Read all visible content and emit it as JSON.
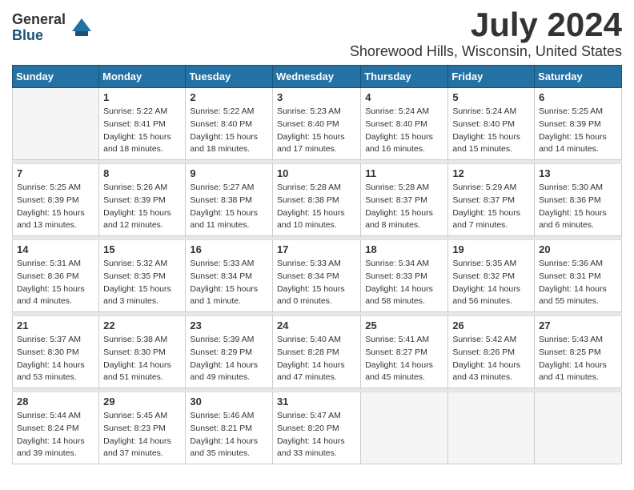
{
  "logo": {
    "general": "General",
    "blue": "Blue"
  },
  "title": "July 2024",
  "location": "Shorewood Hills, Wisconsin, United States",
  "days_of_week": [
    "Sunday",
    "Monday",
    "Tuesday",
    "Wednesday",
    "Thursday",
    "Friday",
    "Saturday"
  ],
  "weeks": [
    [
      {
        "day": "",
        "info": ""
      },
      {
        "day": "1",
        "info": "Sunrise: 5:22 AM\nSunset: 8:41 PM\nDaylight: 15 hours\nand 18 minutes."
      },
      {
        "day": "2",
        "info": "Sunrise: 5:22 AM\nSunset: 8:40 PM\nDaylight: 15 hours\nand 18 minutes."
      },
      {
        "day": "3",
        "info": "Sunrise: 5:23 AM\nSunset: 8:40 PM\nDaylight: 15 hours\nand 17 minutes."
      },
      {
        "day": "4",
        "info": "Sunrise: 5:24 AM\nSunset: 8:40 PM\nDaylight: 15 hours\nand 16 minutes."
      },
      {
        "day": "5",
        "info": "Sunrise: 5:24 AM\nSunset: 8:40 PM\nDaylight: 15 hours\nand 15 minutes."
      },
      {
        "day": "6",
        "info": "Sunrise: 5:25 AM\nSunset: 8:39 PM\nDaylight: 15 hours\nand 14 minutes."
      }
    ],
    [
      {
        "day": "7",
        "info": "Sunrise: 5:25 AM\nSunset: 8:39 PM\nDaylight: 15 hours\nand 13 minutes."
      },
      {
        "day": "8",
        "info": "Sunrise: 5:26 AM\nSunset: 8:39 PM\nDaylight: 15 hours\nand 12 minutes."
      },
      {
        "day": "9",
        "info": "Sunrise: 5:27 AM\nSunset: 8:38 PM\nDaylight: 15 hours\nand 11 minutes."
      },
      {
        "day": "10",
        "info": "Sunrise: 5:28 AM\nSunset: 8:38 PM\nDaylight: 15 hours\nand 10 minutes."
      },
      {
        "day": "11",
        "info": "Sunrise: 5:28 AM\nSunset: 8:37 PM\nDaylight: 15 hours\nand 8 minutes."
      },
      {
        "day": "12",
        "info": "Sunrise: 5:29 AM\nSunset: 8:37 PM\nDaylight: 15 hours\nand 7 minutes."
      },
      {
        "day": "13",
        "info": "Sunrise: 5:30 AM\nSunset: 8:36 PM\nDaylight: 15 hours\nand 6 minutes."
      }
    ],
    [
      {
        "day": "14",
        "info": "Sunrise: 5:31 AM\nSunset: 8:36 PM\nDaylight: 15 hours\nand 4 minutes."
      },
      {
        "day": "15",
        "info": "Sunrise: 5:32 AM\nSunset: 8:35 PM\nDaylight: 15 hours\nand 3 minutes."
      },
      {
        "day": "16",
        "info": "Sunrise: 5:33 AM\nSunset: 8:34 PM\nDaylight: 15 hours\nand 1 minute."
      },
      {
        "day": "17",
        "info": "Sunrise: 5:33 AM\nSunset: 8:34 PM\nDaylight: 15 hours\nand 0 minutes."
      },
      {
        "day": "18",
        "info": "Sunrise: 5:34 AM\nSunset: 8:33 PM\nDaylight: 14 hours\nand 58 minutes."
      },
      {
        "day": "19",
        "info": "Sunrise: 5:35 AM\nSunset: 8:32 PM\nDaylight: 14 hours\nand 56 minutes."
      },
      {
        "day": "20",
        "info": "Sunrise: 5:36 AM\nSunset: 8:31 PM\nDaylight: 14 hours\nand 55 minutes."
      }
    ],
    [
      {
        "day": "21",
        "info": "Sunrise: 5:37 AM\nSunset: 8:30 PM\nDaylight: 14 hours\nand 53 minutes."
      },
      {
        "day": "22",
        "info": "Sunrise: 5:38 AM\nSunset: 8:30 PM\nDaylight: 14 hours\nand 51 minutes."
      },
      {
        "day": "23",
        "info": "Sunrise: 5:39 AM\nSunset: 8:29 PM\nDaylight: 14 hours\nand 49 minutes."
      },
      {
        "day": "24",
        "info": "Sunrise: 5:40 AM\nSunset: 8:28 PM\nDaylight: 14 hours\nand 47 minutes."
      },
      {
        "day": "25",
        "info": "Sunrise: 5:41 AM\nSunset: 8:27 PM\nDaylight: 14 hours\nand 45 minutes."
      },
      {
        "day": "26",
        "info": "Sunrise: 5:42 AM\nSunset: 8:26 PM\nDaylight: 14 hours\nand 43 minutes."
      },
      {
        "day": "27",
        "info": "Sunrise: 5:43 AM\nSunset: 8:25 PM\nDaylight: 14 hours\nand 41 minutes."
      }
    ],
    [
      {
        "day": "28",
        "info": "Sunrise: 5:44 AM\nSunset: 8:24 PM\nDaylight: 14 hours\nand 39 minutes."
      },
      {
        "day": "29",
        "info": "Sunrise: 5:45 AM\nSunset: 8:23 PM\nDaylight: 14 hours\nand 37 minutes."
      },
      {
        "day": "30",
        "info": "Sunrise: 5:46 AM\nSunset: 8:21 PM\nDaylight: 14 hours\nand 35 minutes."
      },
      {
        "day": "31",
        "info": "Sunrise: 5:47 AM\nSunset: 8:20 PM\nDaylight: 14 hours\nand 33 minutes."
      },
      {
        "day": "",
        "info": ""
      },
      {
        "day": "",
        "info": ""
      },
      {
        "day": "",
        "info": ""
      }
    ]
  ]
}
